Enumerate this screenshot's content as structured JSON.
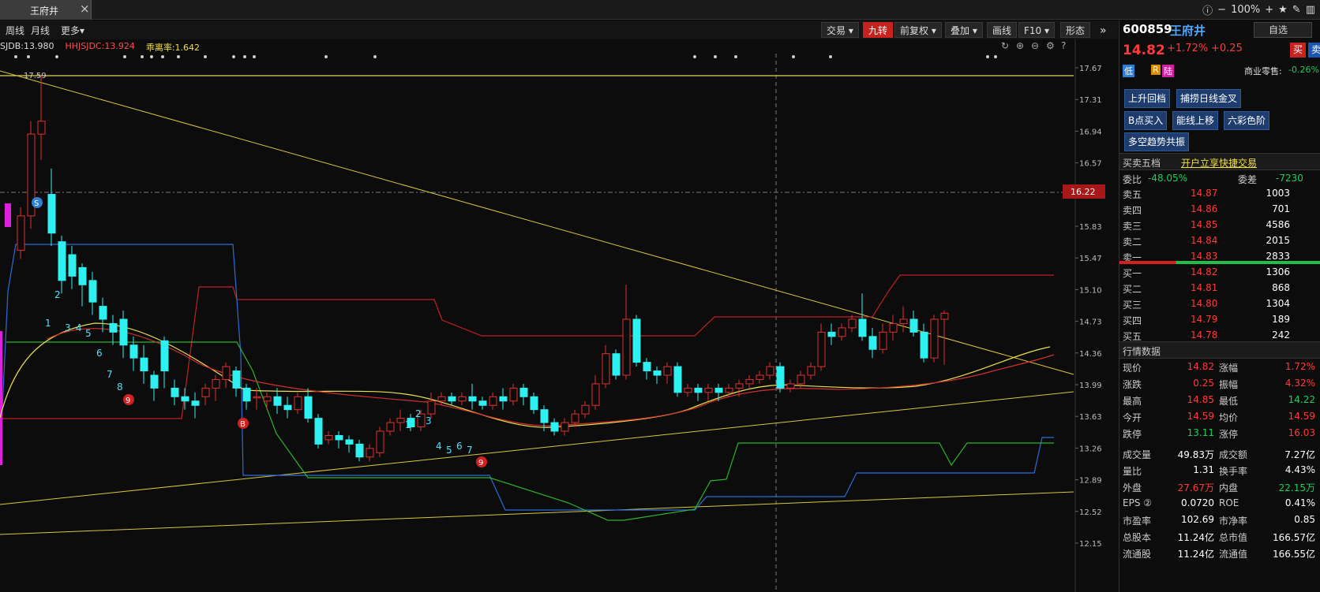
{
  "tab": {
    "title": "王府井",
    "close": "×"
  },
  "top_right": {
    "zoom": "100%"
  },
  "toolbar": {
    "left": [
      "周线",
      "月线",
      "更多▾"
    ],
    "right": [
      "交易 ▾",
      "九转",
      "前复权 ▾",
      "叠加 ▾",
      "画线",
      "F10 ▾",
      "形态",
      "»"
    ]
  },
  "indicators": {
    "a": "SJDB:13.980",
    "b": "HHJSJDC:13.924",
    "c": "乖离率:1.642"
  },
  "price_axis": [
    "17.67",
    "17.31",
    "16.94",
    "16.57",
    "16.22",
    "15.83",
    "15.47",
    "15.10",
    "14.73",
    "14.36",
    "13.99",
    "13.63",
    "13.26",
    "12.89",
    "12.52",
    "12.15"
  ],
  "crosshair_price": "16.22",
  "peak_label": "17.59",
  "td_labels": [
    "1",
    "2",
    "3",
    "4",
    "5",
    "6",
    "7",
    "8",
    "1",
    "2",
    "3",
    "4",
    "5",
    "6",
    "7",
    "8"
  ],
  "markers": {
    "s": "S",
    "b": "B",
    "nine": "9"
  },
  "chart_data": {
    "type": "candlestick",
    "ylim": [
      12.15,
      17.67
    ],
    "candles": [
      [
        15.55,
        15.95,
        15.45,
        16.05
      ],
      [
        15.95,
        16.9,
        15.8,
        17.05
      ],
      [
        16.9,
        17.05,
        16.6,
        17.59
      ],
      [
        16.2,
        15.75,
        15.6,
        16.5
      ],
      [
        15.65,
        15.2,
        15.05,
        15.72
      ],
      [
        15.5,
        15.25,
        15.1,
        15.6
      ],
      [
        15.35,
        15.15,
        14.9,
        15.4
      ],
      [
        15.2,
        14.95,
        14.8,
        15.3
      ],
      [
        14.9,
        14.75,
        14.6,
        15.0
      ],
      [
        14.7,
        14.6,
        14.45,
        14.8
      ],
      [
        14.75,
        14.45,
        14.3,
        14.85
      ],
      [
        14.45,
        14.3,
        14.15,
        14.55
      ],
      [
        14.3,
        14.15,
        14.0,
        14.45
      ],
      [
        14.1,
        13.95,
        13.8,
        14.15
      ],
      [
        14.5,
        14.15,
        13.95,
        14.55
      ],
      [
        13.95,
        13.85,
        13.75,
        14.05
      ],
      [
        13.85,
        13.8,
        13.7,
        13.95
      ],
      [
        13.8,
        13.75,
        13.6,
        13.9
      ],
      [
        13.85,
        13.95,
        13.75,
        14.0
      ],
      [
        13.95,
        14.05,
        13.8,
        14.1
      ],
      [
        14.05,
        14.2,
        13.95,
        14.25
      ],
      [
        14.15,
        13.95,
        13.85,
        14.2
      ],
      [
        13.95,
        13.8,
        13.7,
        14.0
      ],
      [
        13.85,
        13.85,
        13.7,
        13.95
      ]
    ],
    "price_now": 14.82
  },
  "panel": {
    "code": "600859",
    "name": "王府井",
    "price": "14.82",
    "pct": "+1.72%",
    "chg": "+0.25",
    "sell_btn": "卖",
    "buy_btn": "买",
    "self_select": "自选",
    "tags": [
      "低",
      "R",
      "陆"
    ],
    "industry": "商业零售:",
    "industry_pct": "-0.26%",
    "signals": [
      "上升回档",
      "捕捞日线金叉",
      "B点买入",
      "能线上移",
      "六彩色阶",
      "多空趋势共振"
    ],
    "orderbook_title": "买卖五档",
    "quick_trade": "开户立享快捷交易",
    "wb_label": "委比",
    "wb_value": "-48.05%",
    "wc_label": "委差",
    "wc_value": "-7230",
    "asks": [
      [
        "卖五",
        "14.87",
        "1003"
      ],
      [
        "卖四",
        "14.86",
        "701"
      ],
      [
        "卖三",
        "14.85",
        "4586"
      ],
      [
        "卖二",
        "14.84",
        "2015"
      ],
      [
        "卖一",
        "14.83",
        "2833"
      ]
    ],
    "bids": [
      [
        "买一",
        "14.82",
        "1306"
      ],
      [
        "买二",
        "14.81",
        "868"
      ],
      [
        "买三",
        "14.80",
        "1304"
      ],
      [
        "买四",
        "14.79",
        "189"
      ],
      [
        "买五",
        "14.78",
        "242"
      ]
    ],
    "quote_title": "行情数据",
    "quote": [
      [
        "现价",
        "14.82",
        "涨幅",
        "1.72%"
      ],
      [
        "涨跌",
        "0.25",
        "振幅",
        "4.32%"
      ],
      [
        "最高",
        "14.85",
        "最低",
        "14.22"
      ],
      [
        "今开",
        "14.59",
        "均价",
        "14.59"
      ],
      [
        "跌停",
        "13.11",
        "涨停",
        "16.03"
      ],
      [
        "成交量",
        "49.83万",
        "成交额",
        "7.27亿"
      ],
      [
        "量比",
        "1.31",
        "换手率",
        "4.43%"
      ],
      [
        "外盘",
        "27.67万",
        "内盘",
        "22.15万"
      ],
      [
        "EPS ②",
        "0.0720",
        "ROE",
        "0.41%"
      ],
      [
        "市盈率",
        "102.69",
        "市净率",
        "0.85"
      ],
      [
        "总股本",
        "11.24亿",
        "总市值",
        "166.57亿"
      ],
      [
        "流通股",
        "11.24亿",
        "流通值",
        "166.55亿"
      ]
    ]
  }
}
